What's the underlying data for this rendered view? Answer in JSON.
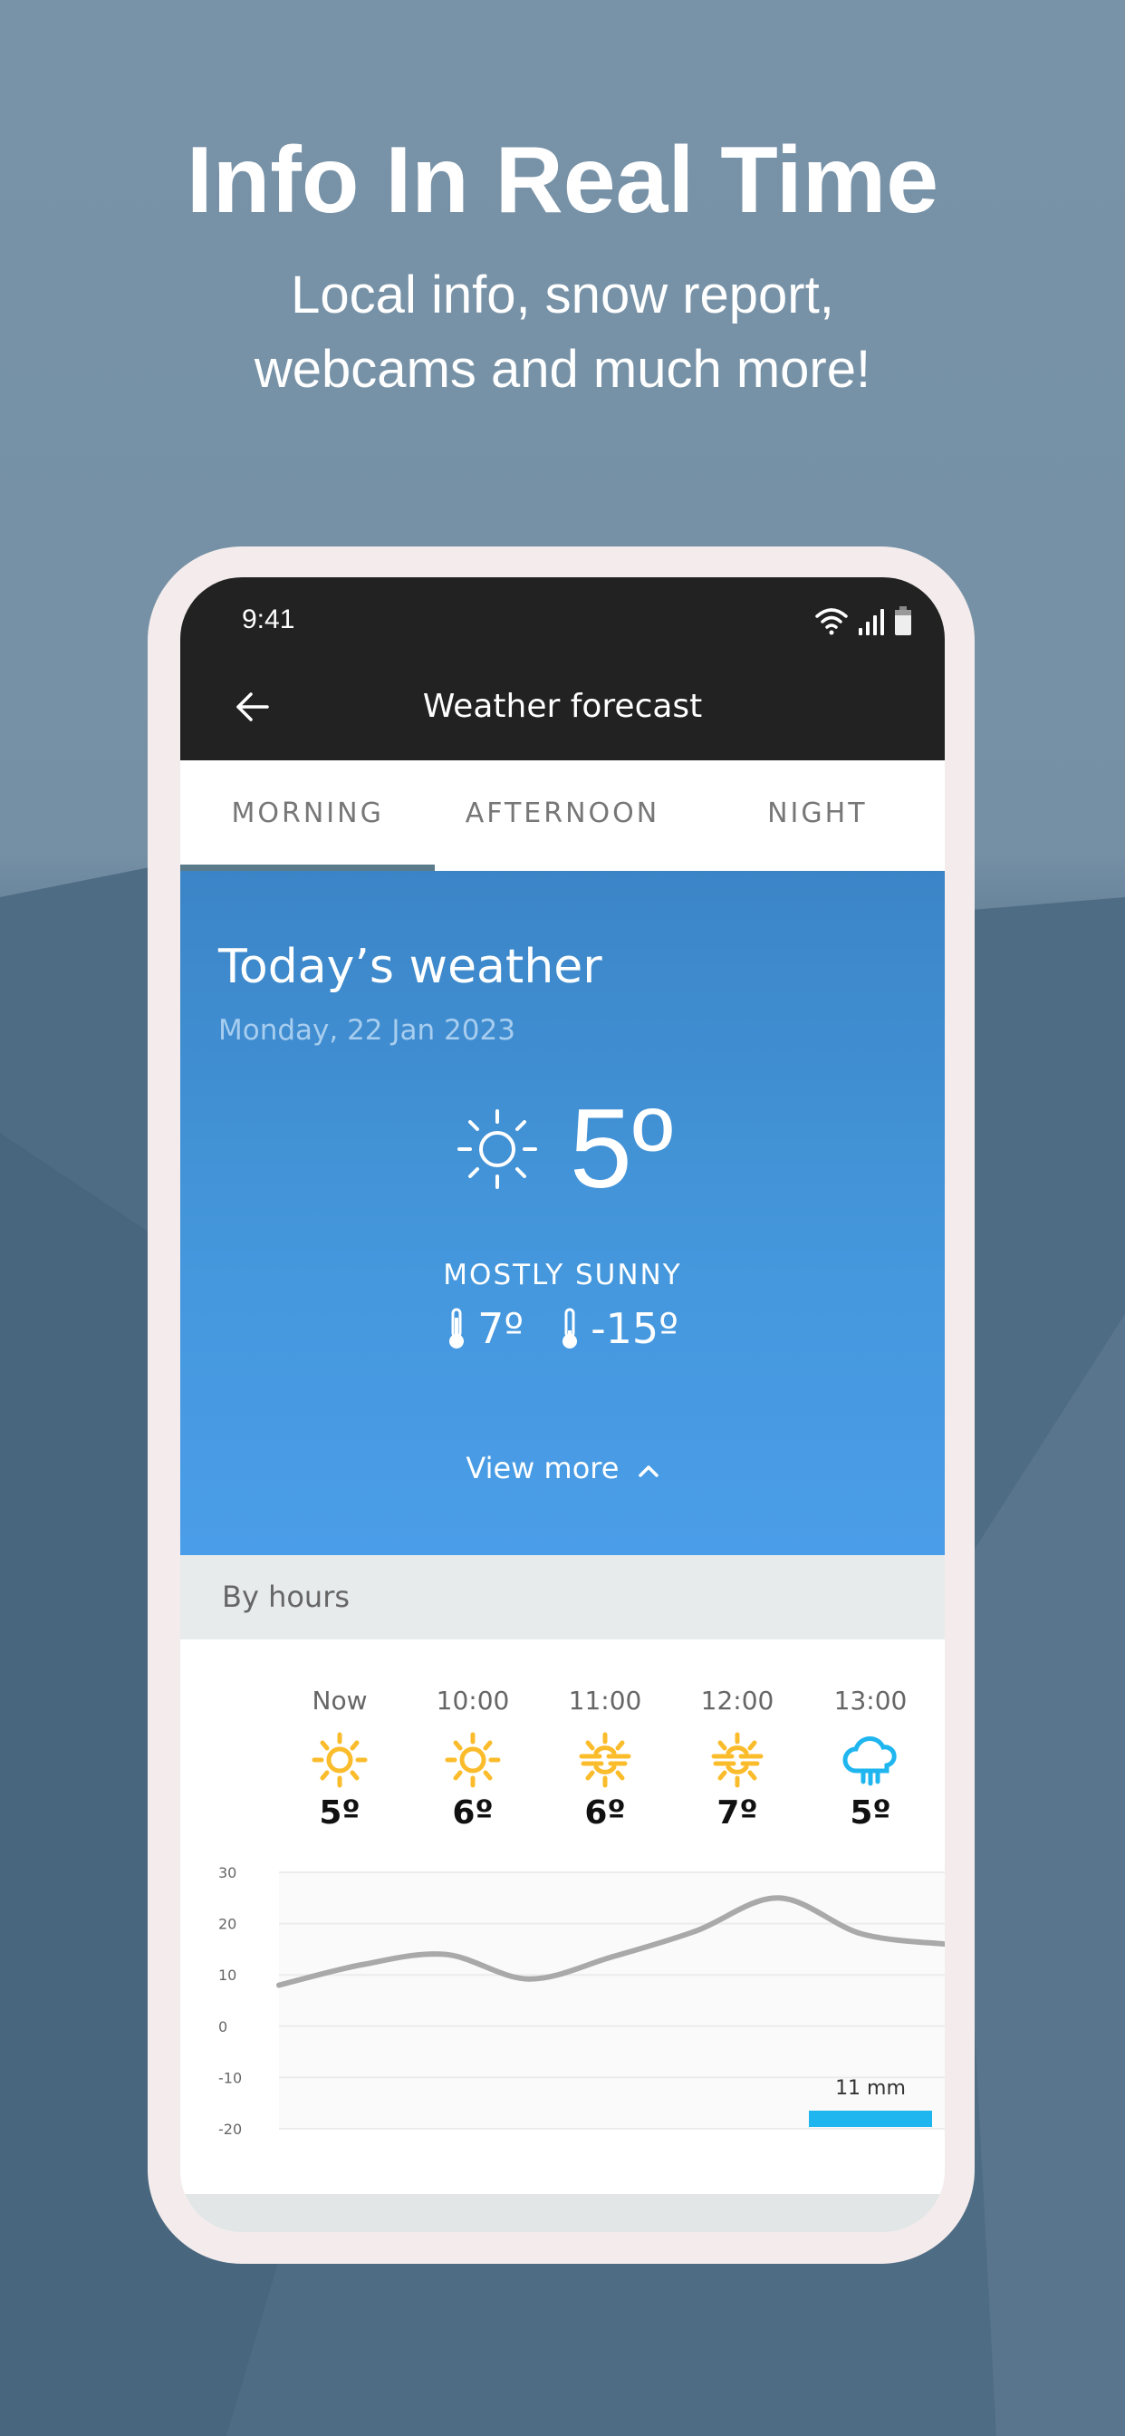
{
  "hero": {
    "title": "Info In Real Time",
    "subtitle_line1": "Local info, snow report,",
    "subtitle_line2": "webcams and much more!"
  },
  "status_bar": {
    "time": "9:41",
    "icons": [
      "wifi-icon",
      "signal-icon",
      "battery-icon"
    ]
  },
  "header": {
    "title": "Weather forecast",
    "back_icon": "arrow-left-icon"
  },
  "tabs": [
    {
      "label": "MORNING",
      "active": true
    },
    {
      "label": "AFTERNOON",
      "active": false
    },
    {
      "label": "NIGHT",
      "active": false
    }
  ],
  "today": {
    "title": "Today’s weather",
    "date": "Monday, 22 Jan 2023",
    "icon": "sun-icon",
    "temperature": "5º",
    "condition": "MOSTLY SUNNY",
    "max": "7º",
    "min": "-15º",
    "view_more": "View more"
  },
  "by_hours": {
    "label": "By hours",
    "hours": [
      {
        "time": "Now",
        "icon": "sun-icon",
        "temp": "5º"
      },
      {
        "time": "10:00",
        "icon": "sun-icon",
        "temp": "6º"
      },
      {
        "time": "11:00",
        "icon": "sun-haze-icon",
        "temp": "6º"
      },
      {
        "time": "12:00",
        "icon": "sun-haze-icon",
        "temp": "7º"
      },
      {
        "time": "13:00",
        "icon": "cloud-rain-icon",
        "temp": "5º"
      }
    ]
  },
  "colors": {
    "sun": "#fbbc2c",
    "rain": "#1fb6ef",
    "tab_indicator": "#5b7a8a",
    "panel": "#4392da"
  },
  "chart_data": {
    "type": "line",
    "yticks": [
      "30",
      "20",
      "10",
      "0",
      "-10",
      "-20"
    ],
    "ylim": [
      -20,
      30
    ],
    "grid": true,
    "temperature_series": [
      8,
      12,
      14,
      9.2,
      13.5,
      18.5,
      25,
      18,
      16
    ],
    "precipitation": {
      "label": "11 mm",
      "value": 11,
      "hour": "13:00"
    }
  }
}
